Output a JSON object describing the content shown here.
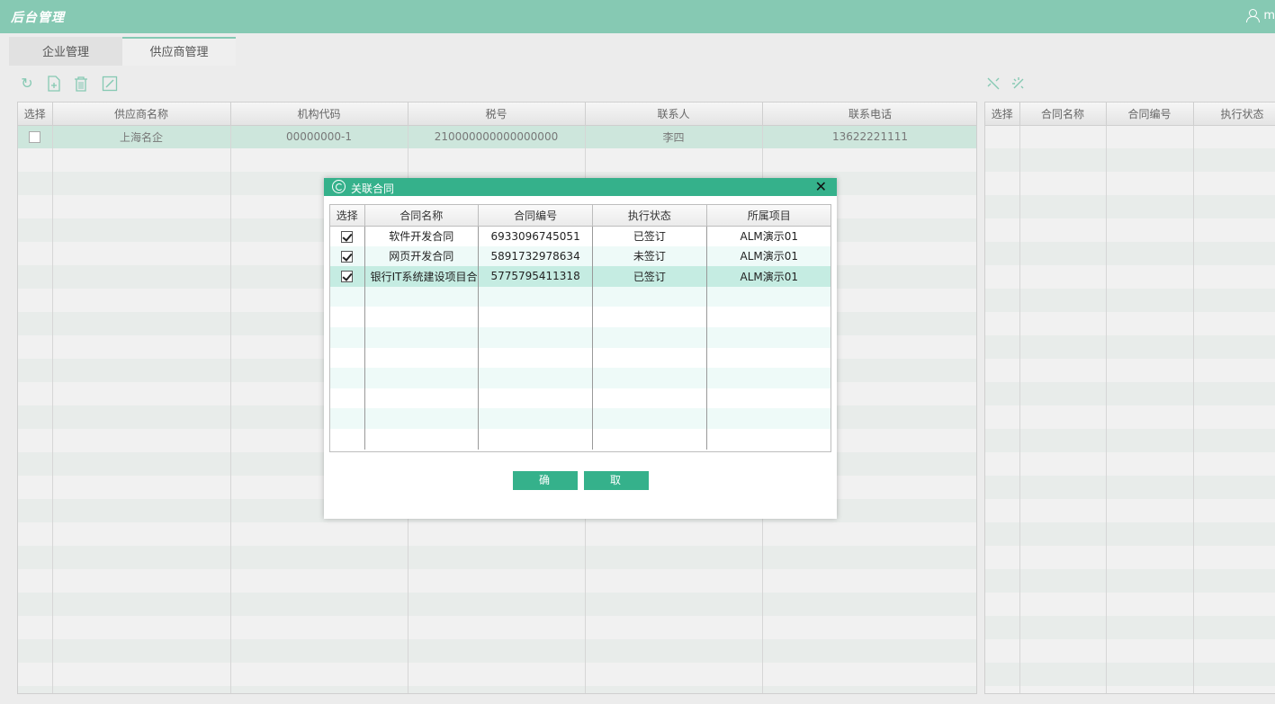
{
  "header": {
    "title": "后台管理",
    "user": "m"
  },
  "tabs": [
    {
      "label": "企业管理"
    },
    {
      "label": "供应商管理"
    }
  ],
  "toolbar": {
    "left_icons": [
      "refresh-icon",
      "add-file-icon",
      "delete-icon",
      "edit-icon"
    ],
    "right_icons": [
      "unlink-icon",
      "link-icon"
    ]
  },
  "supplier_grid": {
    "columns": [
      "选择",
      "供应商名称",
      "机构代码",
      "税号",
      "联系人",
      "联系电话"
    ],
    "rows": [
      {
        "name": "上海名企",
        "org_code": "00000000-1",
        "tax_no": "210000000000000000",
        "contact": "李四",
        "phone": "13622221111"
      }
    ]
  },
  "contract_grid": {
    "columns": [
      "选择",
      "合同名称",
      "合同编号",
      "执行状态"
    ]
  },
  "dialog": {
    "title": "关联合同",
    "columns": [
      "选择",
      "合同名称",
      "合同编号",
      "执行状态",
      "所属项目"
    ],
    "rows": [
      {
        "name": "软件开发合同",
        "number": "6933096745051",
        "status": "已签订",
        "project": "ALM演示01",
        "checked": true
      },
      {
        "name": "网页开发合同",
        "number": "5891732978634",
        "status": "未签订",
        "project": "ALM演示01",
        "checked": true
      },
      {
        "name": "银行IT系统建设项目合同",
        "number": "5775795411318",
        "status": "已签订",
        "project": "ALM演示01",
        "checked": true
      }
    ],
    "confirm_label": "确定",
    "cancel_label": "取消"
  },
  "colors": {
    "header": "#86c9b3",
    "dialog_accent": "#35b18b"
  }
}
